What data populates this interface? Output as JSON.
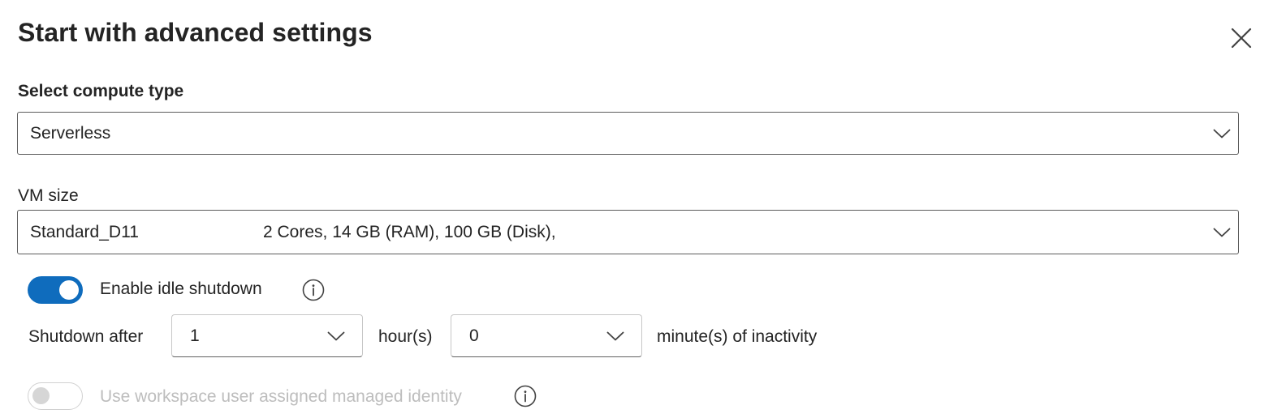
{
  "dialog": {
    "title": "Start with advanced settings",
    "close_icon": "close-icon"
  },
  "compute_type": {
    "label": "Select compute type",
    "value": "Serverless"
  },
  "vm_size": {
    "label": "VM size",
    "name": "Standard_D11",
    "specs": "2 Cores, 14 GB (RAM), 100 GB (Disk),"
  },
  "idle_shutdown": {
    "enabled": true,
    "label": "Enable idle shutdown",
    "info_icon": "info-icon",
    "prefix": "Shutdown after",
    "hours_value": "1",
    "hours_unit": "hour(s)",
    "minutes_value": "0",
    "minutes_suffix": "minute(s) of inactivity"
  },
  "managed_identity": {
    "enabled": false,
    "disabled": true,
    "label": "Use workspace user assigned managed identity",
    "info_icon": "info-icon"
  },
  "colors": {
    "accent": "#0f6cbd",
    "text": "#242424",
    "disabled_text": "#bdbdbd"
  }
}
